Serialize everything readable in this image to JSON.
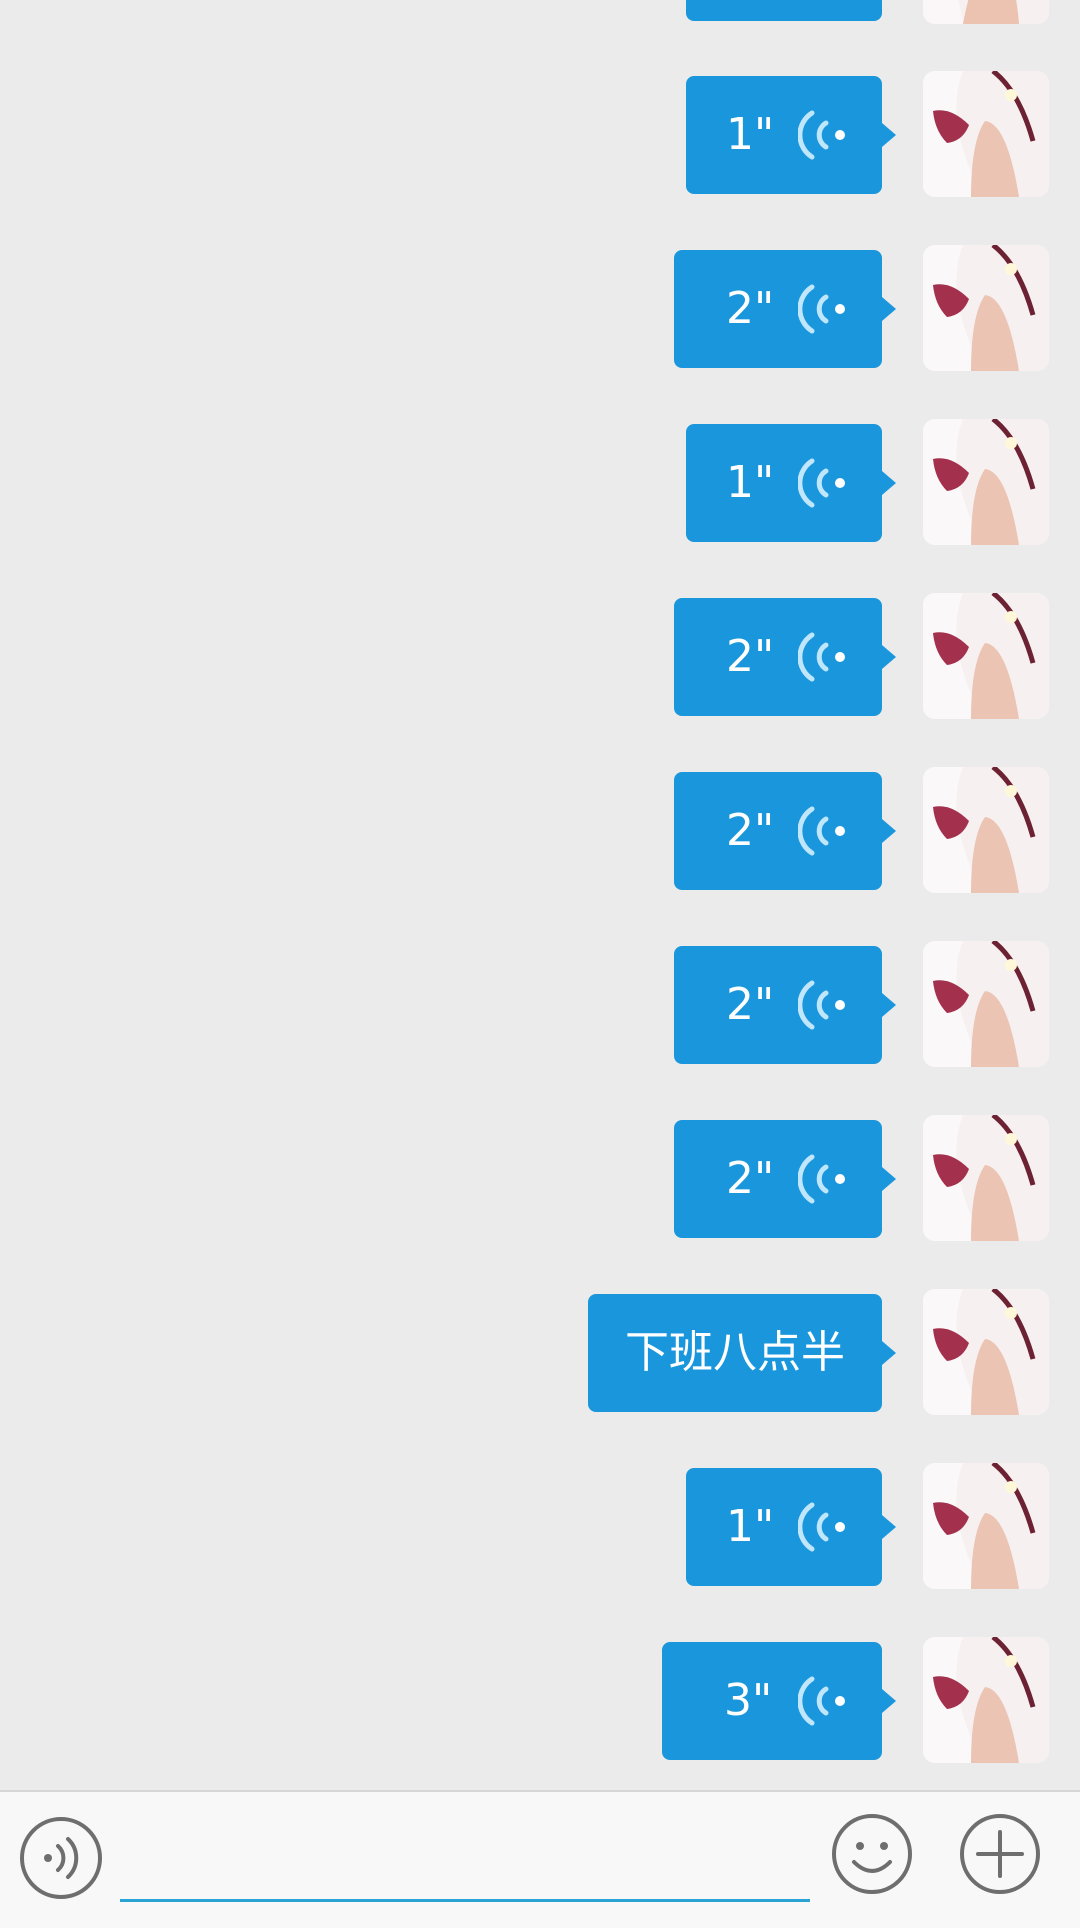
{
  "conversation": {
    "messages": [
      {
        "type": "voice",
        "duration": "",
        "sender": "me",
        "partial": true
      },
      {
        "type": "voice",
        "duration": "1\"",
        "sender": "me"
      },
      {
        "type": "voice",
        "duration": "2\"",
        "sender": "me"
      },
      {
        "type": "voice",
        "duration": "1\"",
        "sender": "me"
      },
      {
        "type": "voice",
        "duration": "2\"",
        "sender": "me"
      },
      {
        "type": "voice",
        "duration": "2\"",
        "sender": "me"
      },
      {
        "type": "voice",
        "duration": "2\"",
        "sender": "me"
      },
      {
        "type": "voice",
        "duration": "2\"",
        "sender": "me"
      },
      {
        "type": "text",
        "text": "下班八点半",
        "sender": "me"
      },
      {
        "type": "voice",
        "duration": "1\"",
        "sender": "me"
      },
      {
        "type": "voice",
        "duration": "3\"",
        "sender": "me"
      }
    ]
  },
  "input_bar": {
    "message_value": "",
    "message_placeholder": "",
    "voice_toggle_icon": "voice-mode-icon",
    "emoji_icon": "smiley-icon",
    "plus_icon": "plus-circle-icon"
  },
  "colors": {
    "background": "#ebebeb",
    "bubble": "#1a97dc",
    "bubble_text": "#ffffff",
    "wave_icon": "#bfe6fb",
    "input_underline": "#2aa4d5",
    "icon_gray": "#6e6e6e"
  }
}
